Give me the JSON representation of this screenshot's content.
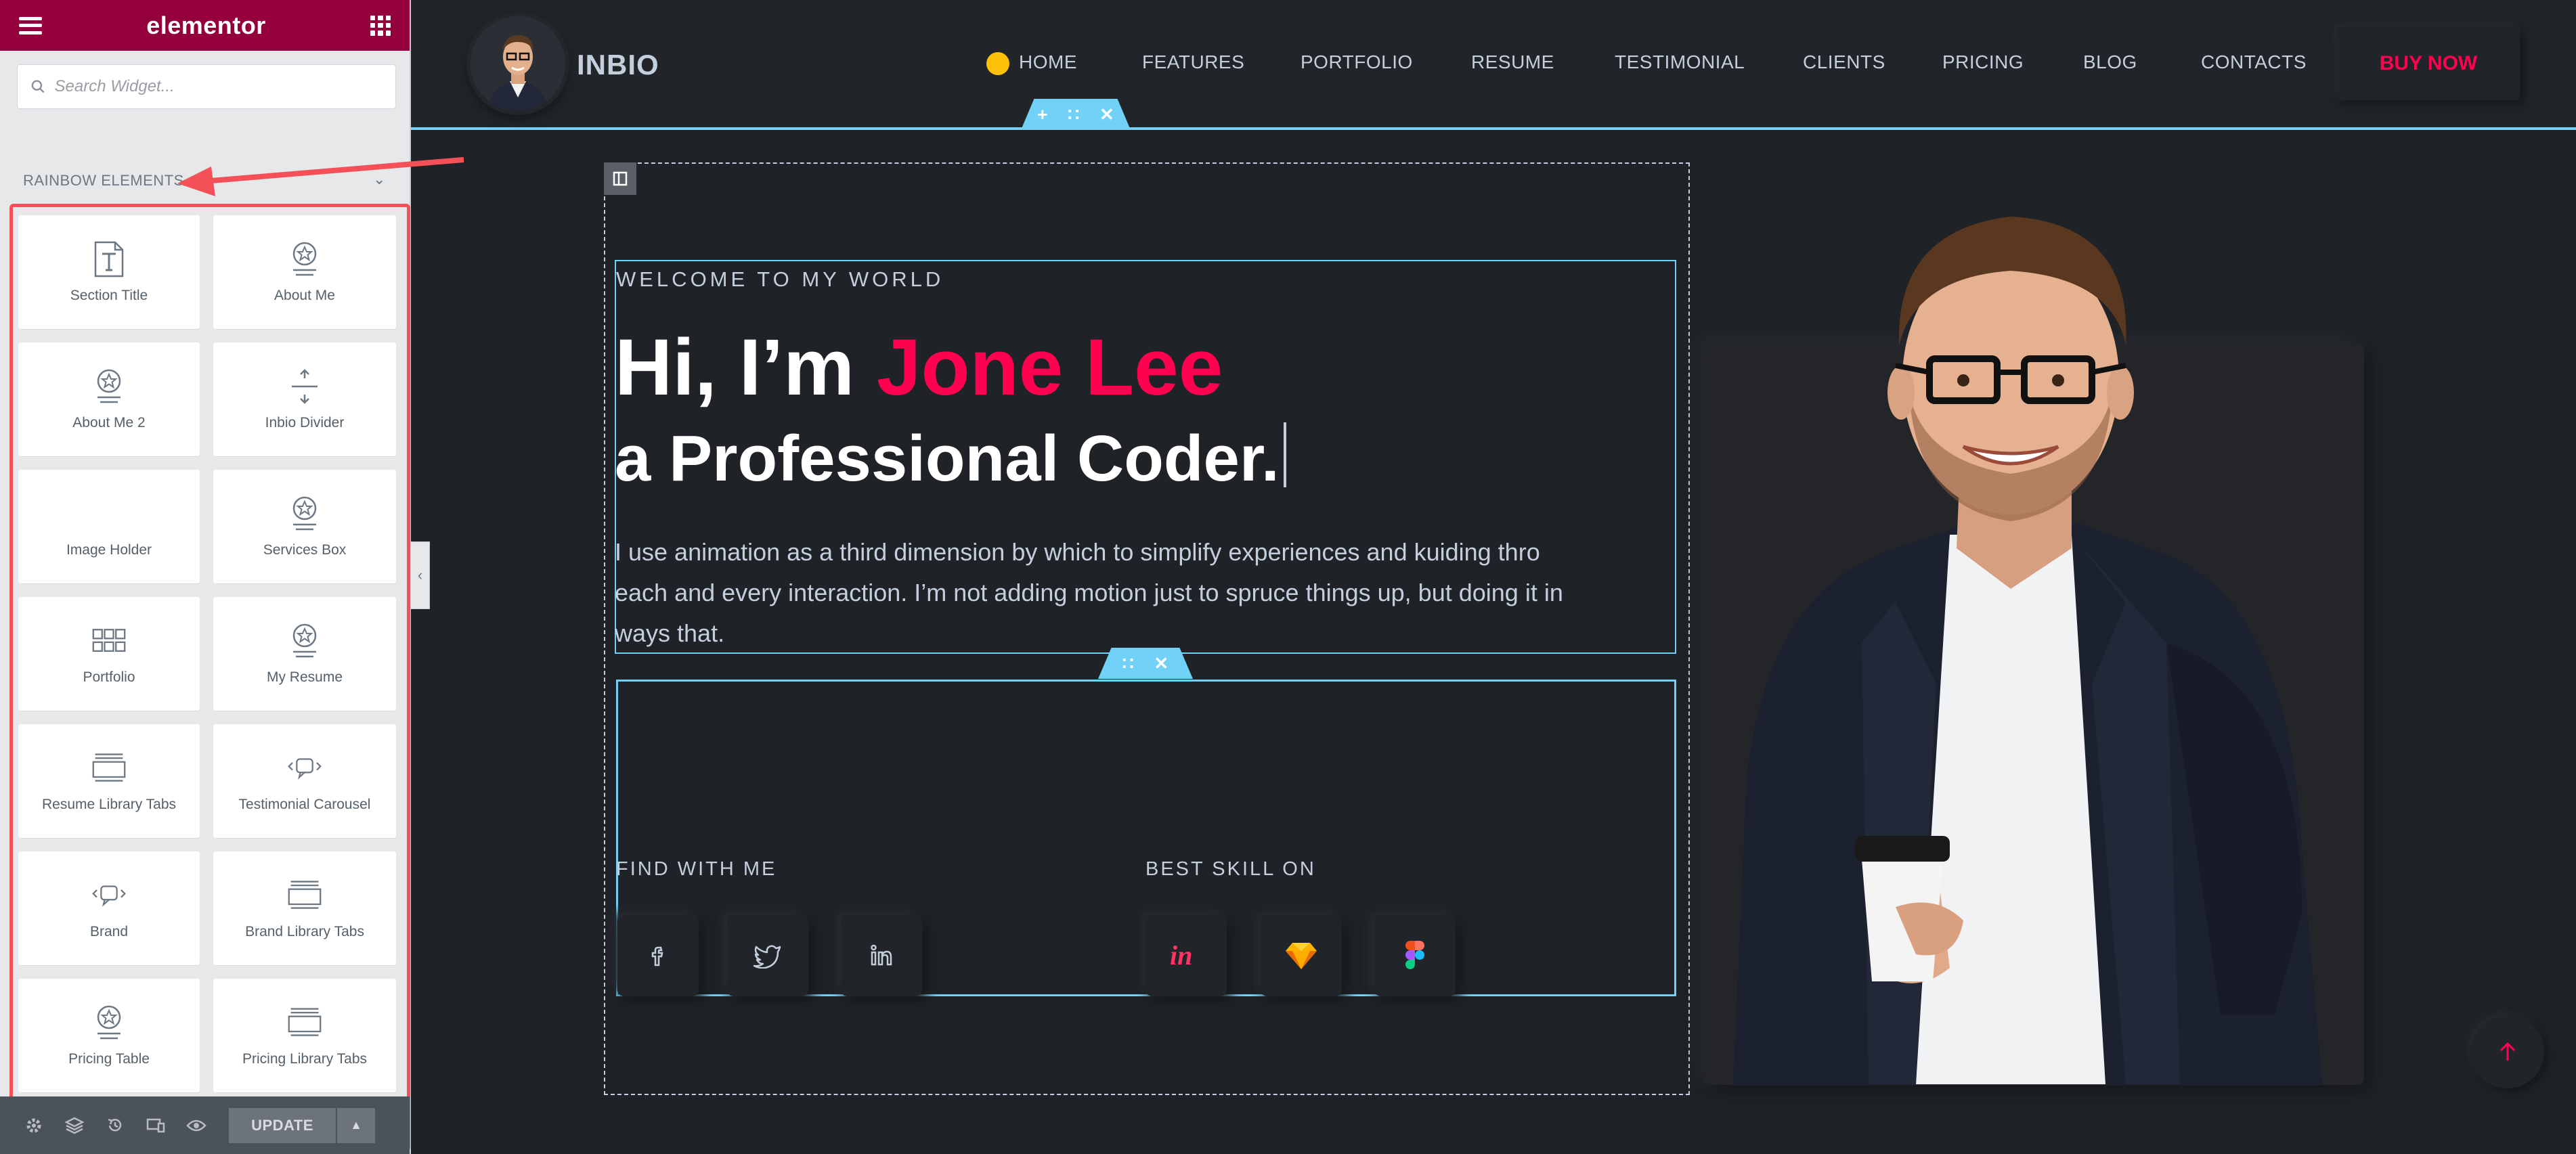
{
  "panel": {
    "brand": "elementor",
    "search_placeholder": "Search Widget...",
    "category_title": "RAINBOW ELEMENTS",
    "widgets": [
      {
        "label": "Section Title",
        "icon": "text-icon"
      },
      {
        "label": "About Me",
        "icon": "badge-icon"
      },
      {
        "label": "About Me 2",
        "icon": "badge-icon"
      },
      {
        "label": "Inbio Divider",
        "icon": "divider-icon"
      },
      {
        "label": "Image Holder",
        "icon": "none"
      },
      {
        "label": "Services Box",
        "icon": "badge-icon"
      },
      {
        "label": "Portfolio",
        "icon": "gallery-grid-icon"
      },
      {
        "label": "My Resume",
        "icon": "badge-icon"
      },
      {
        "label": "Resume Library Tabs",
        "icon": "tabs-icon"
      },
      {
        "label": "Testimonial Carousel",
        "icon": "carousel-icon"
      },
      {
        "label": "Brand",
        "icon": "carousel-icon"
      },
      {
        "label": "Brand Library Tabs",
        "icon": "tabs-icon"
      },
      {
        "label": "Pricing Table",
        "icon": "badge-icon"
      },
      {
        "label": "Pricing Library Tabs",
        "icon": "tabs-icon"
      }
    ],
    "footer": {
      "update_label": "UPDATE"
    }
  },
  "site": {
    "logo_text": "INBIO",
    "nav": [
      "HOME",
      "FEATURES",
      "PORTFOLIO",
      "RESUME",
      "TESTIMONIAL",
      "CLIENTS",
      "PRICING",
      "BLOG",
      "CONTACTS"
    ],
    "buy_label": "BUY NOW",
    "hero": {
      "welcome": "WELCOME TO MY WORLD",
      "hello_prefix": "Hi, I’m ",
      "name": "Jone Lee",
      "role": "a Professional Coder.",
      "intro": "I use animation as a third dimension by which to simplify experiences and kuiding thro each and every interaction. I’m not adding motion just to spruce things up, but doing it in ways that.",
      "find_label": "FIND WITH ME",
      "skill_label": "BEST SKILL ON"
    }
  },
  "colors": {
    "elementor_brand": "#93003c",
    "accent": "#ff014f",
    "editor_blue": "#71d1f7",
    "site_bg": "#212428",
    "annotation_red": "#f45058"
  }
}
